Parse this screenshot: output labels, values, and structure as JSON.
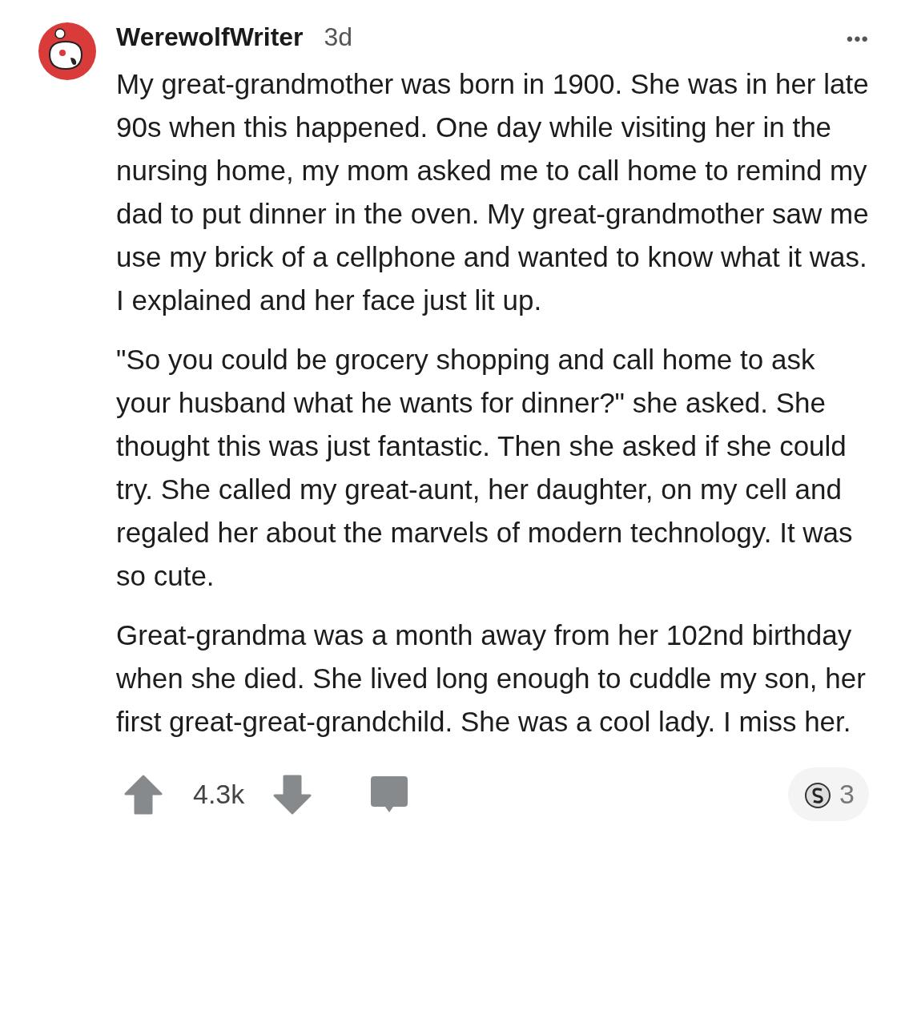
{
  "comment": {
    "author": "WerewolfWriter",
    "age": "3d",
    "more": "•••",
    "paragraphs": [
      "My great-grandmother was born in 1900. She was in her late 90s when this happened. One day while visiting her in the nursing home, my mom asked me to call home to remind my dad to put dinner in the oven. My great-grandmother saw me use my brick of a cellphone and wanted to know what it was. I explained and her face just lit up.",
      "\"So you could be grocery shopping and call home to ask your husband what he wants for dinner?\" she asked. She thought this was just fantastic. Then she asked if she could try. She called my great-aunt, her daughter, on my cell and regaled her about the marvels of modern technology. It was so cute.",
      "Great-grandma was a month away from her 102nd birthday when she died. She lived long enough to cuddle my son, her first great-great-grandchild. She was a cool lady. I miss her."
    ],
    "votes": "4.3k",
    "awards": "3"
  }
}
